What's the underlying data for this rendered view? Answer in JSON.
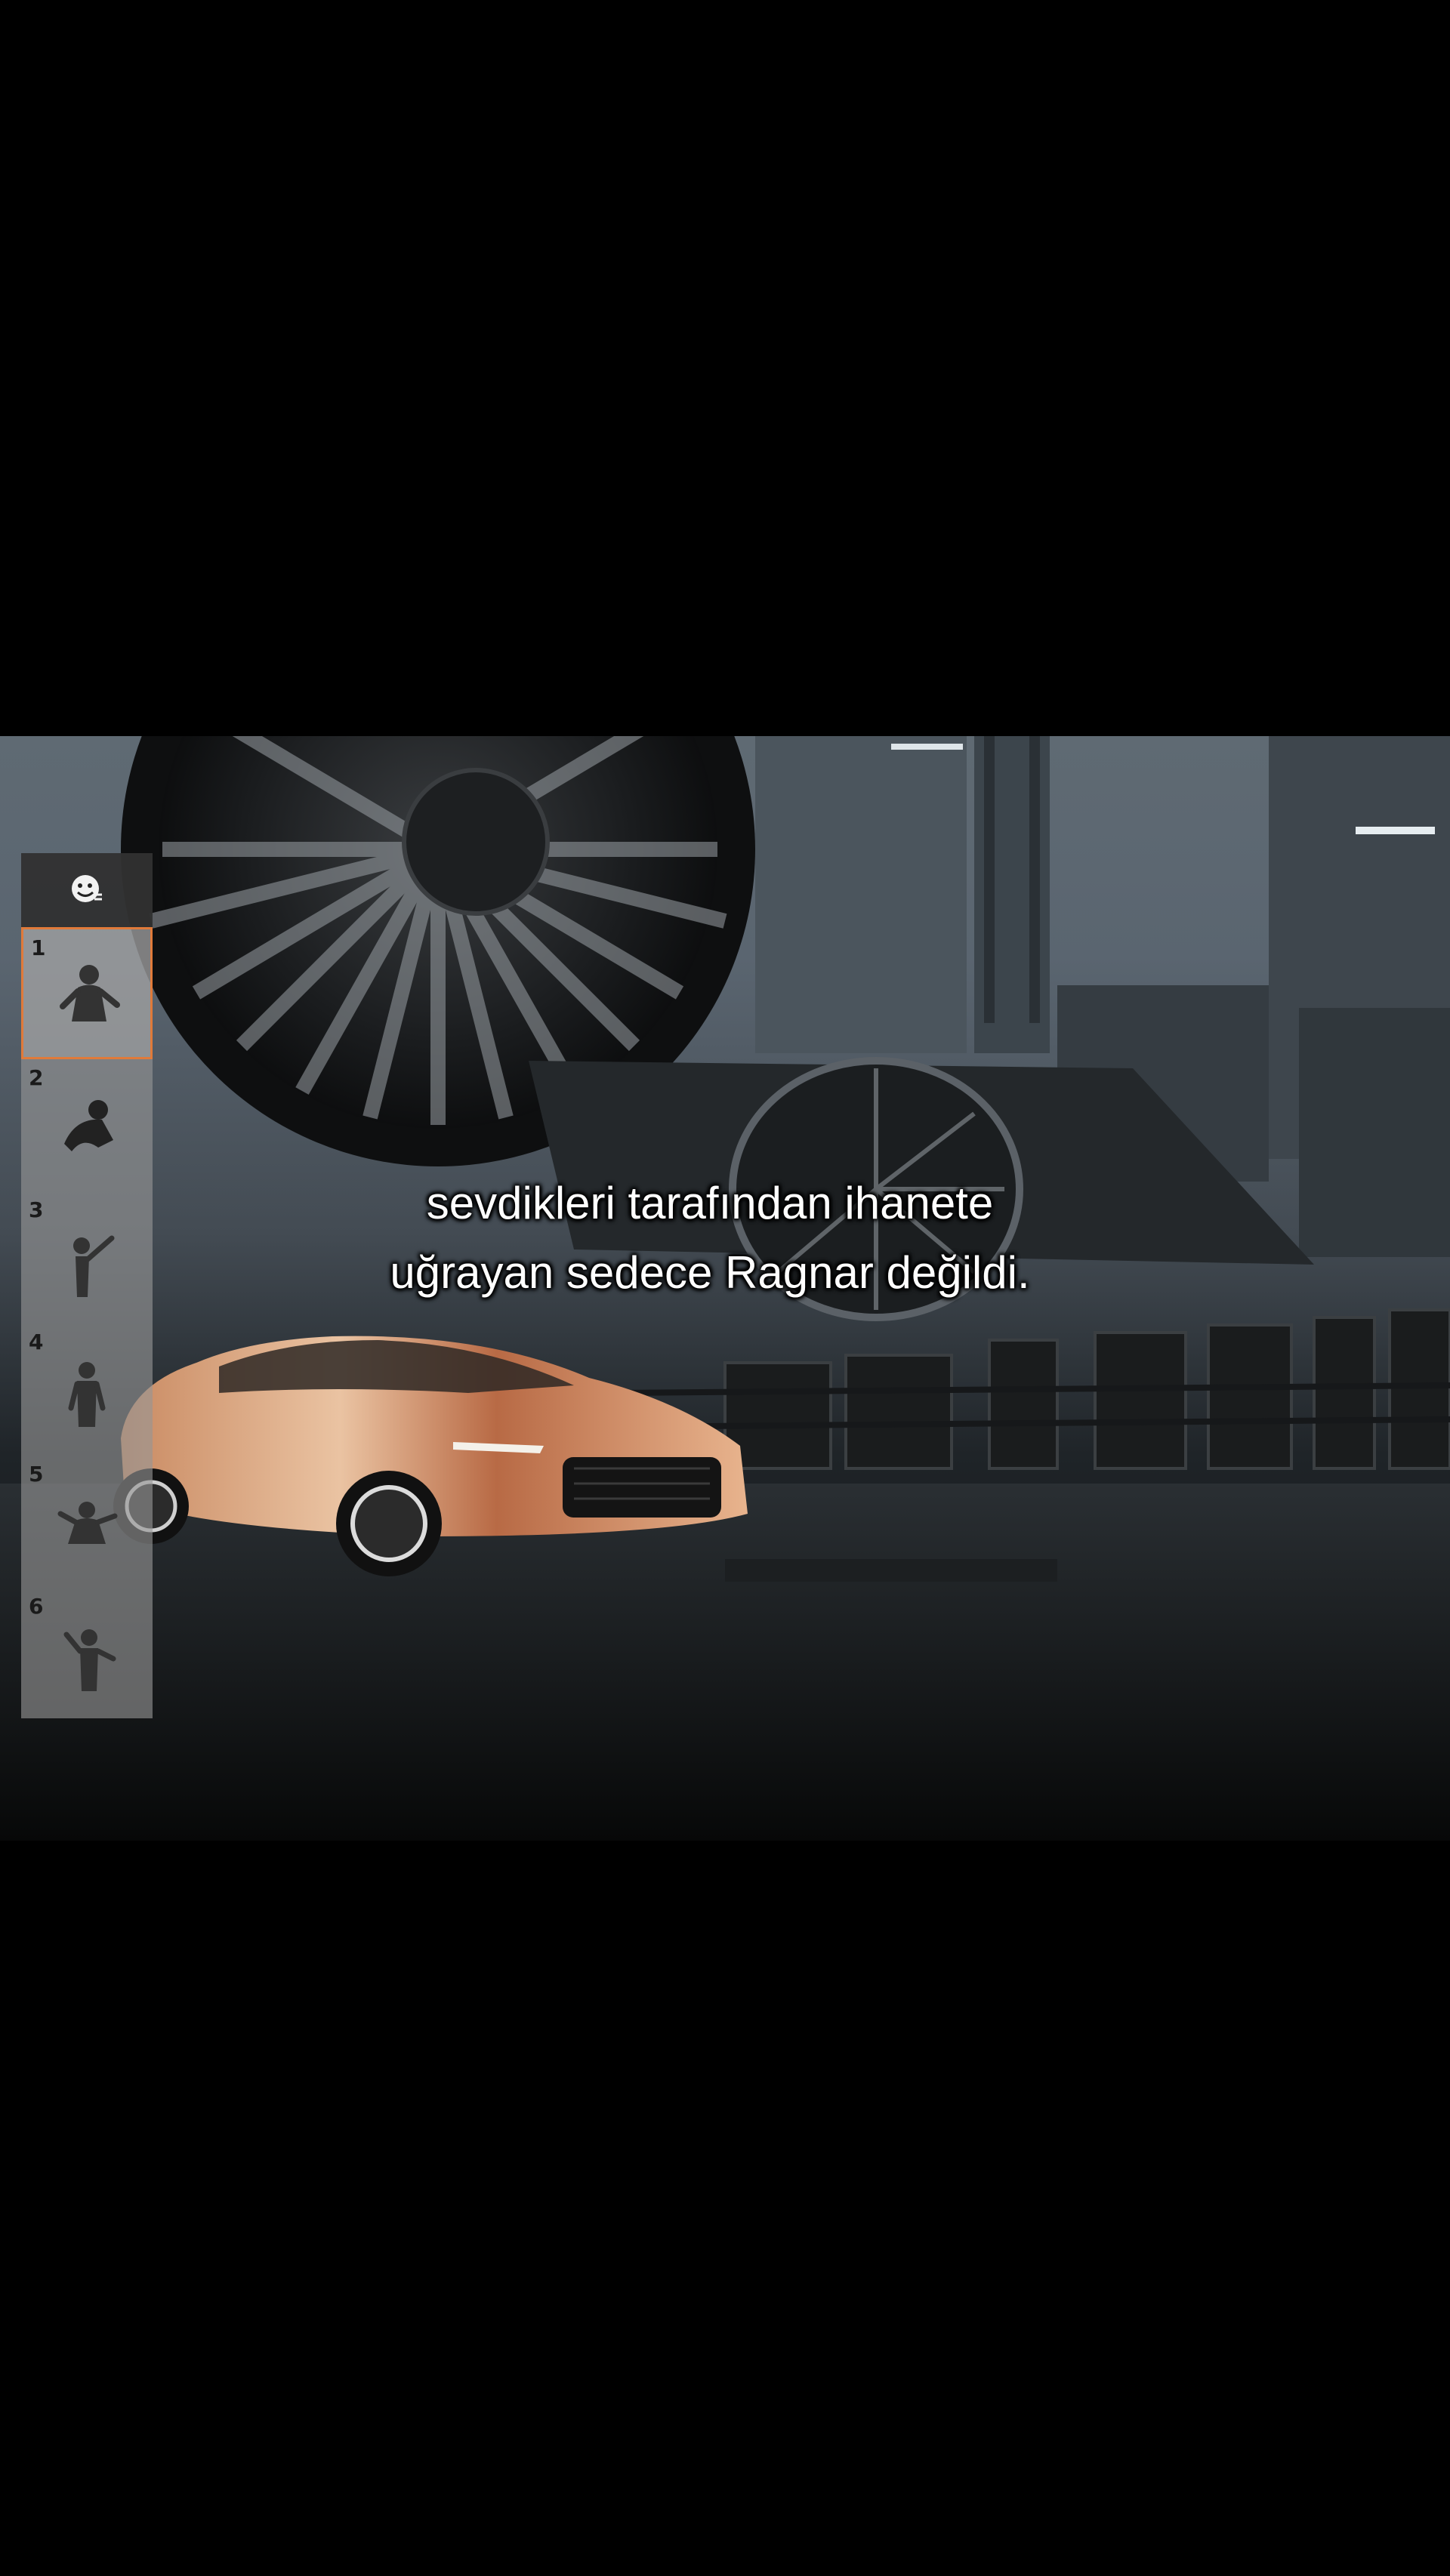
{
  "subtitle": {
    "line1": "sevdikleri tarafından ihanete",
    "line2": "uğrayan sedece Ragnar değildi."
  },
  "emote_panel": {
    "header_icon": "emoji-face-icon",
    "selected_slot": 1,
    "slots": [
      {
        "number": "1",
        "icon": "dance-pose-icon"
      },
      {
        "number": "2",
        "icon": "crouch-pose-icon"
      },
      {
        "number": "3",
        "icon": "point-pose-icon"
      },
      {
        "number": "4",
        "icon": "stand-pose-icon"
      },
      {
        "number": "5",
        "icon": "wave-pose-icon"
      },
      {
        "number": "6",
        "icon": "cheer-pose-icon"
      }
    ]
  },
  "colors": {
    "selected_border": "#e07a3a",
    "panel_bg": "#969696",
    "car_body": "#d8a07a"
  }
}
